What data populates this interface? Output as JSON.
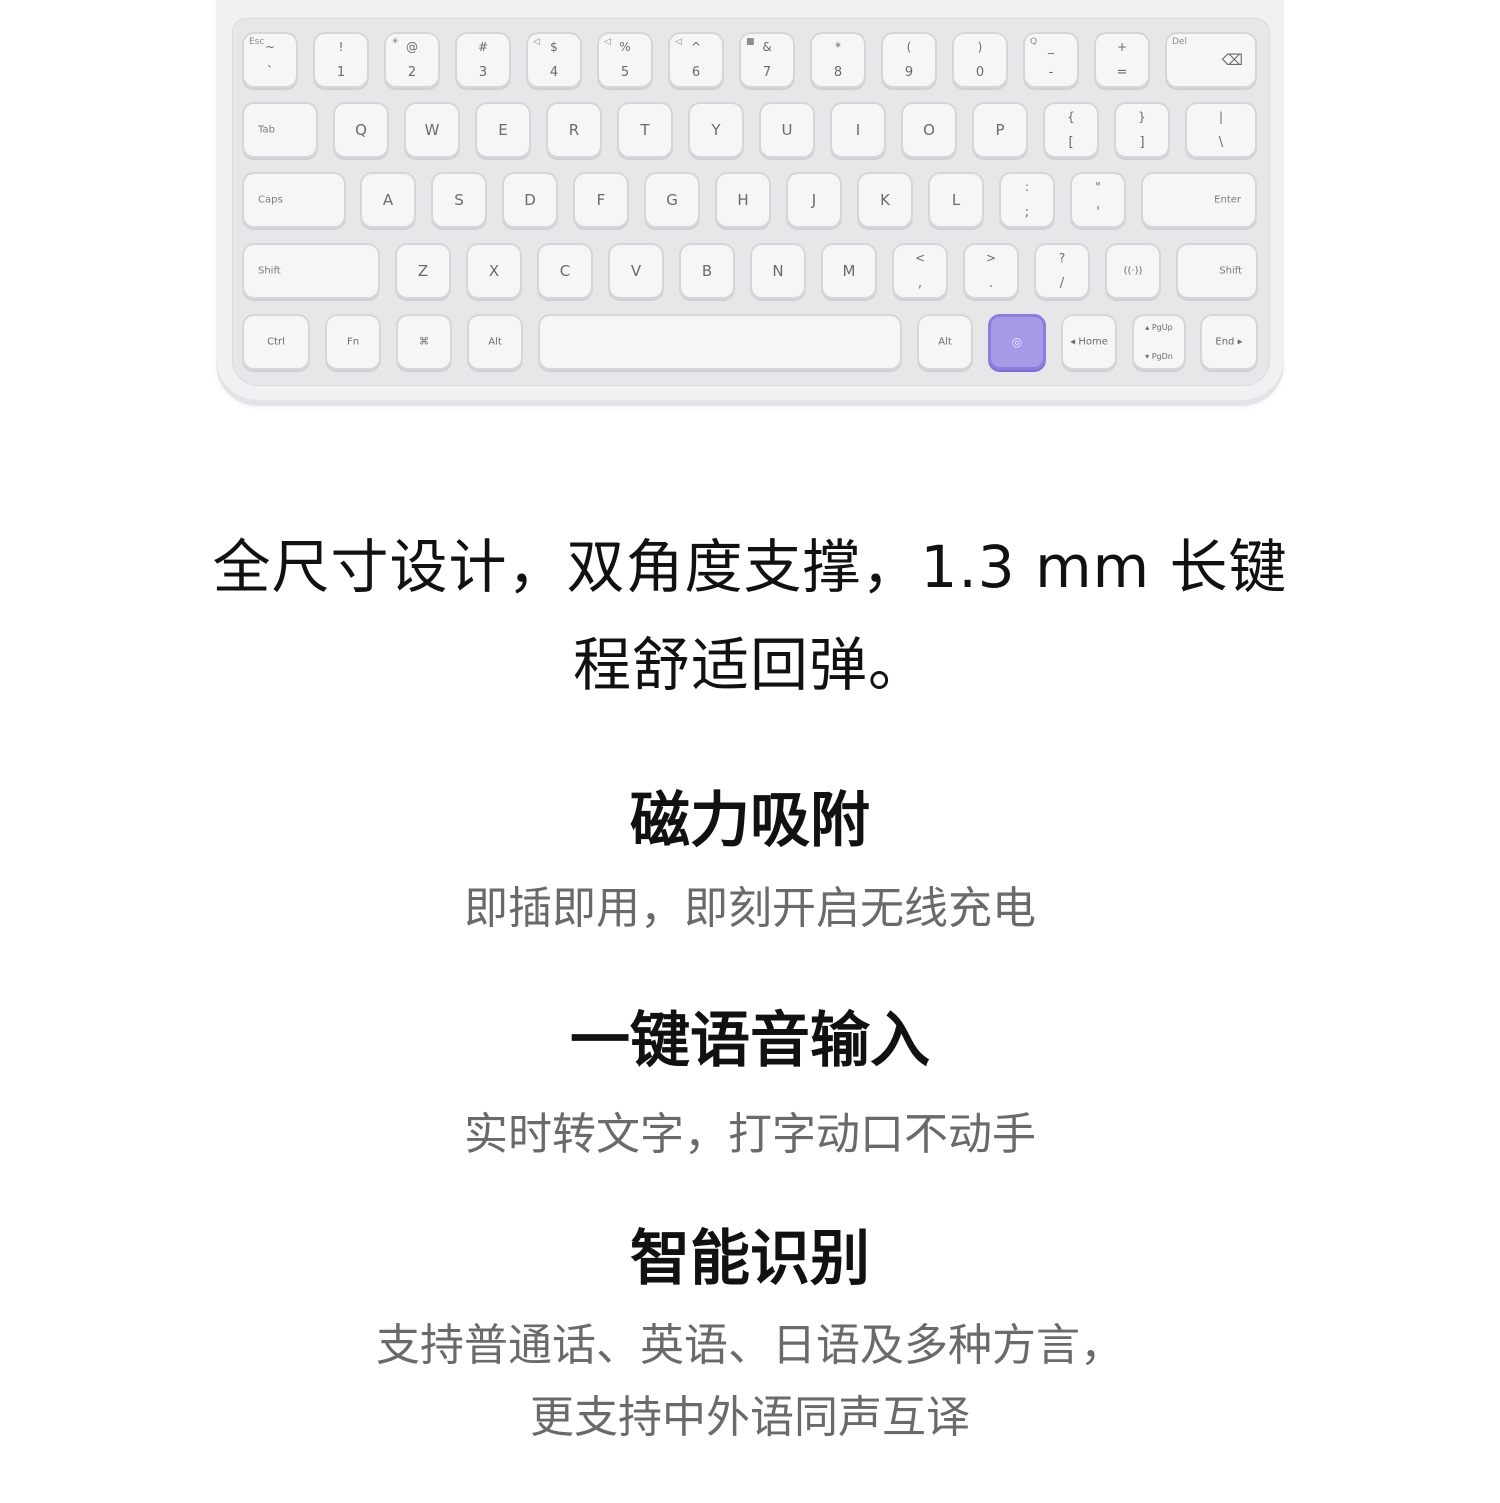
{
  "keyboard": {
    "row1": [
      {
        "fn": "Esc",
        "top": "~",
        "bot": "`"
      },
      {
        "fn": "",
        "top": "!",
        "bot": "1"
      },
      {
        "fn": "☀",
        "top": "@",
        "bot": "2"
      },
      {
        "fn": "",
        "top": "#",
        "bot": "3"
      },
      {
        "fn": "◁",
        "top": "$",
        "bot": "4"
      },
      {
        "fn": "◁",
        "top": "%",
        "bot": "5"
      },
      {
        "fn": "◁",
        "top": "^",
        "bot": "6"
      },
      {
        "fn": "■",
        "top": "&",
        "bot": "7"
      },
      {
        "fn": "",
        "top": "*",
        "bot": "8"
      },
      {
        "fn": "",
        "top": "(",
        "bot": "9"
      },
      {
        "fn": "",
        "top": ")",
        "bot": "0"
      },
      {
        "fn": "Q",
        "top": "_",
        "bot": "-"
      },
      {
        "fn": "",
        "top": "+",
        "bot": "="
      },
      {
        "fn": "Del",
        "top": "",
        "bot": "⌫"
      }
    ],
    "row2": [
      "Tab",
      "Q",
      "W",
      "E",
      "R",
      "T",
      "Y",
      "U",
      "I",
      "O",
      "P",
      "{ [",
      "} ]",
      "| \\"
    ],
    "row3": [
      "Caps",
      "A",
      "S",
      "D",
      "F",
      "G",
      "H",
      "J",
      "K",
      "L",
      ": ;",
      "\" '",
      "Enter"
    ],
    "row4": [
      "Shift",
      "Z",
      "X",
      "C",
      "V",
      "B",
      "N",
      "M",
      "< ,",
      "> .",
      "? /",
      "((·))",
      "Shift"
    ],
    "row5": [
      "Ctrl",
      "Fn",
      "⌘",
      "Alt",
      "",
      "Alt",
      "◎",
      "◂ Home",
      "▴ PgUp ▾ PgDn",
      "End ▸"
    ]
  },
  "headline": {
    "line1": "全尺寸设计，双角度支撑，1.3 mm 长键",
    "line2": "程舒适回弹。"
  },
  "features": [
    {
      "title": "磁力吸附",
      "desc": "即插即用，即刻开启无线充电"
    },
    {
      "title": "一键语音输入",
      "desc": "实时转文字，打字动口不动手"
    },
    {
      "title": "智能识别",
      "desc_line1": "支持普通话、英语、日语及多种方言，",
      "desc_line2": "更支持中外语同声互译"
    }
  ]
}
